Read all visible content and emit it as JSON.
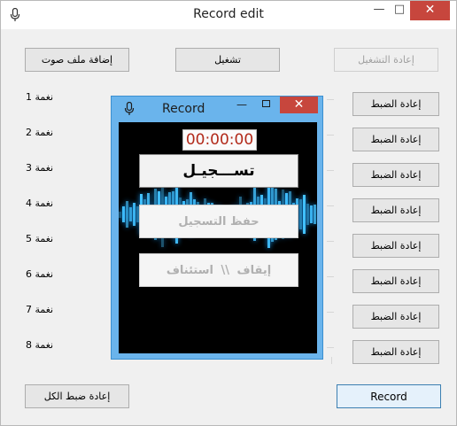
{
  "window": {
    "title": "Record edit",
    "icon": "microphone-icon",
    "controls": {
      "minimize": "—",
      "maximize": "□",
      "close": "✕"
    }
  },
  "toolbar": {
    "add_audio_label": "إضافة ملف صوت",
    "play_label": "تشغيل",
    "replay_label": "إعادة التشغيل"
  },
  "tones": [
    {
      "label": "نغمة 1",
      "reset_label": "إعادة الضبط"
    },
    {
      "label": "نغمة 2",
      "reset_label": "إعادة الضبط"
    },
    {
      "label": "نغمة 3",
      "reset_label": "إعادة الضبط"
    },
    {
      "label": "نغمة 4",
      "reset_label": "إعادة الضبط"
    },
    {
      "label": "نغمة 5",
      "reset_label": "إعادة الضبط"
    },
    {
      "label": "نغمة 6",
      "reset_label": "إعادة الضبط"
    },
    {
      "label": "نغمة 7",
      "reset_label": "إعادة الضبط"
    },
    {
      "label": "نغمة 8",
      "reset_label": "إعادة الضبط"
    }
  ],
  "footer": {
    "reset_all_label": "إعادة ضبط الكل",
    "record_label": "Record"
  },
  "record_dialog": {
    "title": "Record",
    "icon": "microphone-icon",
    "timer": "00:00:00",
    "record_button_label": "تســـجيـل",
    "save_button_label": "حفظ التسجيل",
    "pause_resume_label": "إيقاف \\\\ استئناف"
  },
  "colors": {
    "close_button": "#c7463d",
    "dialog_frame": "#6ab4ec",
    "sound_wave": "#44c2ff",
    "timer_text": "#b22a1a"
  }
}
